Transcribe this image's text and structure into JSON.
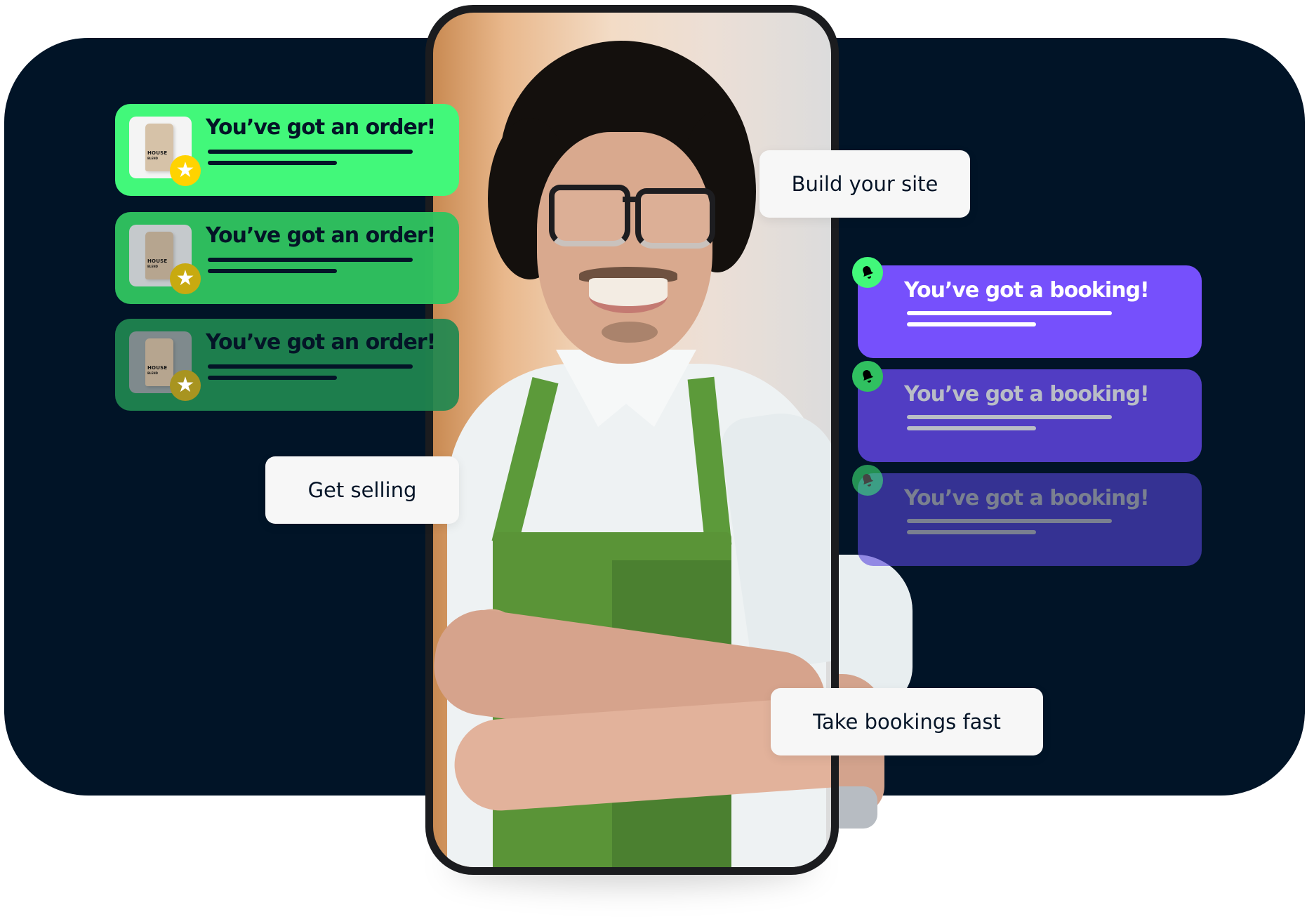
{
  "background": {
    "panel_color": "#011427"
  },
  "phone": {
    "photo_subject": "smiling man with glasses wearing white shirt and green apron, arms crossed"
  },
  "order_notifications": [
    {
      "title": "You’ve got an order!",
      "product_text_1": "HOUSE",
      "product_text_2": "BLEND",
      "badge_icon": "star-icon",
      "color": "#42F87A"
    },
    {
      "title": "You’ve got an order!",
      "product_text_1": "HOUSE",
      "product_text_2": "BLEND",
      "badge_icon": "star-icon",
      "color": "#30C460"
    },
    {
      "title": "You’ve got an order!",
      "product_text_1": "HOUSE",
      "product_text_2": "BLEND",
      "badge_icon": "star-icon",
      "color": "#208850"
    }
  ],
  "booking_notifications": [
    {
      "title": "You’ve got a booking!",
      "badge_icon": "bell-icon",
      "color": "#7650FC"
    },
    {
      "title": "You’ve got a booking!",
      "badge_icon": "bell-icon",
      "color": "#543FC8"
    },
    {
      "title": "You’ve got a booking!",
      "badge_icon": "bell-icon",
      "color": "#37308F"
    }
  ],
  "labels": {
    "build": "Build your site",
    "sell": "Get selling",
    "book": "Take bookings fast"
  },
  "icons": {
    "star": "★",
    "bell": "🔔"
  }
}
